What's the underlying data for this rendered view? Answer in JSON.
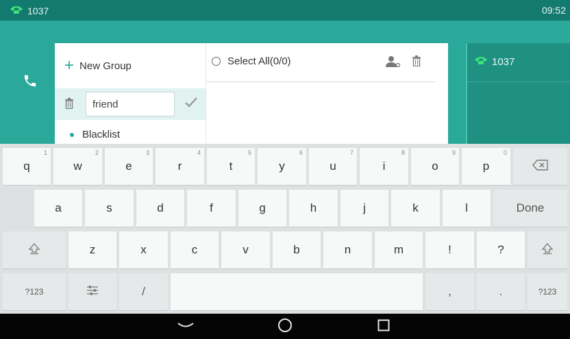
{
  "status_bar": {
    "line_number": "1037",
    "time": "09:52"
  },
  "group_panel": {
    "new_group_label": "New Group",
    "edit_input_value": "friend",
    "blacklist_label": "Blacklist"
  },
  "contacts_panel": {
    "select_all_label": "Select All(0/0)"
  },
  "account_panel": {
    "account_label": "1037"
  },
  "keyboard": {
    "row1": [
      {
        "key": "q",
        "hint": "1"
      },
      {
        "key": "w",
        "hint": "2"
      },
      {
        "key": "e",
        "hint": "3"
      },
      {
        "key": "r",
        "hint": "4"
      },
      {
        "key": "t",
        "hint": "5"
      },
      {
        "key": "y",
        "hint": "6"
      },
      {
        "key": "u",
        "hint": "7"
      },
      {
        "key": "i",
        "hint": "8"
      },
      {
        "key": "o",
        "hint": "9"
      },
      {
        "key": "p",
        "hint": "0"
      }
    ],
    "row2": [
      "a",
      "s",
      "d",
      "f",
      "g",
      "h",
      "j",
      "k",
      "l"
    ],
    "done_label": "Done",
    "row3": [
      "z",
      "x",
      "c",
      "v",
      "b",
      "n",
      "m",
      "!",
      "?"
    ],
    "symbols_label": "?123",
    "slash_label": "/",
    "comma_label": ",",
    "period_label": "."
  },
  "colors": {
    "teal": "#2aa89a",
    "teal_dark": "#137a70",
    "keyboard_bg": "#dde1e1"
  },
  "icons": {
    "phone": "phone-icon",
    "plus": "plus-icon",
    "trash": "trash-icon",
    "check": "check-icon",
    "person": "person-icon",
    "backspace": "backspace-icon",
    "shift": "shift-icon",
    "settings": "settings-icon",
    "nav_back": "chevron-down-icon",
    "nav_home": "circle-home-icon",
    "nav_recent": "square-recent-icon"
  }
}
